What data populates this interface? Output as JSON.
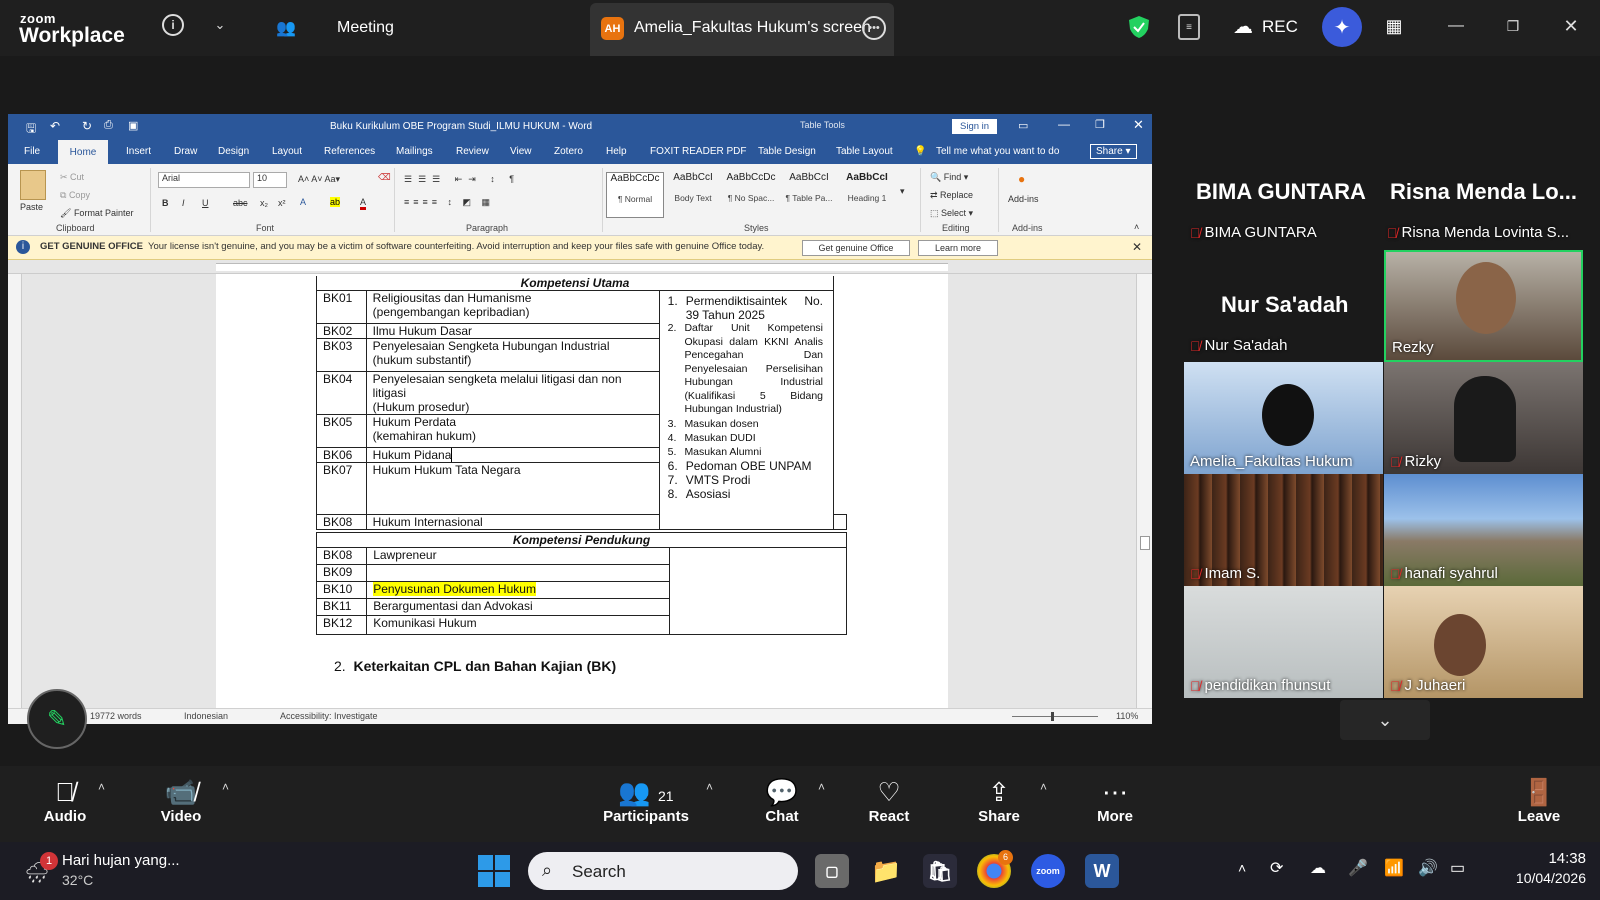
{
  "zoom": {
    "brand_top": "zoom",
    "brand_bottom": "Workplace",
    "meeting_label": "Meeting",
    "share_badge": "AH",
    "share_title": "Amelia_Fakultas Hukum's screen",
    "rec_label": "REC"
  },
  "word": {
    "title": "Buku Kurikulum OBE Program Studi_ILMU HUKUM  -  Word",
    "table_tools": "Table Tools",
    "sign_in": "Sign in",
    "tabs": [
      "File",
      "Home",
      "Insert",
      "Draw",
      "Design",
      "Layout",
      "References",
      "Mailings",
      "Review",
      "View",
      "Zotero",
      "Help",
      "FOXIT READER PDF",
      "Table Design",
      "Table Layout"
    ],
    "tell_me": "Tell me what you want to do",
    "share": "Share",
    "clipboard": {
      "paste": "Paste",
      "cut": "Cut",
      "copy": "Copy",
      "format_painter": "Format Painter",
      "group": "Clipboard"
    },
    "font": {
      "name": "Arial",
      "size": "10",
      "group": "Font"
    },
    "paragraph_group": "Paragraph",
    "styles": [
      {
        "sample": "AaBbCcDc",
        "name": "¶ Normal"
      },
      {
        "sample": "AaBbCcI",
        "name": "Body Text"
      },
      {
        "sample": "AaBbCcDc",
        "name": "¶ No Spac..."
      },
      {
        "sample": "AaBbCcI",
        "name": "¶ Table Pa..."
      },
      {
        "sample": "AaBbCcI",
        "name": "Heading 1"
      }
    ],
    "styles_group": "Styles",
    "editing": {
      "find": "Find",
      "replace": "Replace",
      "select": "Select",
      "group": "Editing"
    },
    "addins": {
      "label": "Add-ins",
      "group": "Add-ins"
    },
    "license": {
      "title": "GET GENUINE OFFICE",
      "message": "Your license isn't genuine, and you may be a victim of software counterfeiting. Avoid interruption and keep your files safe with genuine Office today.",
      "btn1": "Get genuine Office",
      "btn2": "Learn more"
    },
    "doc": {
      "header_main": "Kompetensi Utama",
      "rows_main": [
        {
          "code": "BK01",
          "l1": "Religiousitas dan Humanisme",
          "l2": "(pengembangan kepribadian)"
        },
        {
          "code": "BK02",
          "l1": "Ilmu Hukum Dasar",
          "l2": ""
        },
        {
          "code": "BK03",
          "l1": "Penyelesaian Sengketa Hubungan Industrial",
          "l2": "(hukum substantif)"
        },
        {
          "code": "BK04",
          "l1": "Penyelesaian sengketa melalui litigasi dan non litigasi",
          "l2": "(Hukum prosedur)"
        },
        {
          "code": "BK05",
          "l1": "Hukum Perdata",
          "l2": "(kemahiran hukum)"
        },
        {
          "code": "BK06",
          "l1": "Hukum Pidana",
          "l2": ""
        },
        {
          "code": "BK07",
          "l1": "Hukum Hukum Tata Negara",
          "l2": ""
        },
        {
          "code": "BK08",
          "l1": "Hukum Internasional",
          "l2": ""
        }
      ],
      "sources": [
        {
          "n": "1.",
          "t": "Permendiktisaintek No. 39 Tahun 2025"
        },
        {
          "n": "2.",
          "t": "Daftar Unit Kompetensi Okupasi dalam KKNI Analis Pencegahan Dan Penyelesaian Perselisihan Hubungan Industrial (Kualifikasi 5 Bidang Hubungan Industrial)"
        },
        {
          "n": "3.",
          "t": "Masukan dosen"
        },
        {
          "n": "4.",
          "t": "Masukan DUDI"
        },
        {
          "n": "5.",
          "t": "Masukan Alumni"
        },
        {
          "n": "6.",
          "t": "Pedoman OBE UNPAM"
        },
        {
          "n": "7.",
          "t": "VMTS Prodi"
        },
        {
          "n": "8.",
          "t": "Asosiasi"
        }
      ],
      "header_support": "Kompetensi Pendukung",
      "rows_support": [
        {
          "code": "BK08",
          "l1": "Lawpreneur"
        },
        {
          "code": "BK09",
          "l1": ""
        },
        {
          "code": "BK10",
          "l1": "Penyusunan Dokumen Hukum"
        },
        {
          "code": "BK11",
          "l1": "Berargumentasi dan Advokasi"
        },
        {
          "code": "BK12",
          "l1": "Komunikasi Hukum"
        }
      ],
      "heading_num": "2.",
      "heading": "Keterkaitan CPL dan Bahan Kajian (BK)"
    },
    "status": {
      "words": "19772 words",
      "language": "Indonesian",
      "accessibility": "Accessibility: Investigate",
      "zoom": "110%"
    }
  },
  "gallery": {
    "top_names": [
      {
        "big": "BIMA GUNTARA",
        "small": "BIMA GUNTARA"
      },
      {
        "big": "Risna Menda Lo...",
        "small": "Risna Menda Lovinta S..."
      }
    ],
    "nur": {
      "big": "Nur Sa'adah",
      "small": "Nur Sa'adah"
    },
    "tiles": [
      {
        "name": "Rezky",
        "muted": false
      },
      {
        "name": "Amelia_Fakultas Hukum",
        "muted": false
      },
      {
        "name": "Rizky",
        "muted": true
      },
      {
        "name": "Imam S.",
        "muted": true
      },
      {
        "name": "hanafi syahrul",
        "muted": true
      },
      {
        "name": "pendidikan fhunsut",
        "muted": true
      },
      {
        "name": "J Juhaeri",
        "muted": true
      }
    ]
  },
  "toolbar": {
    "audio": "Audio",
    "video": "Video",
    "participants": "Participants",
    "participants_count": "21",
    "chat": "Chat",
    "react": "React",
    "share": "Share",
    "more": "More",
    "leave": "Leave"
  },
  "taskbar": {
    "weather_title": "Hari hujan yang...",
    "weather_temp": "32°C",
    "weather_badge": "1",
    "search": "Search",
    "chrome_badge": "6",
    "time": "14:38",
    "date": "10/04/2026"
  },
  "colors": {
    "word_blue": "#2b579a",
    "zoom_bar": "#1f1f1f",
    "active_speaker": "#23d160",
    "mute_red": "#e02828"
  }
}
